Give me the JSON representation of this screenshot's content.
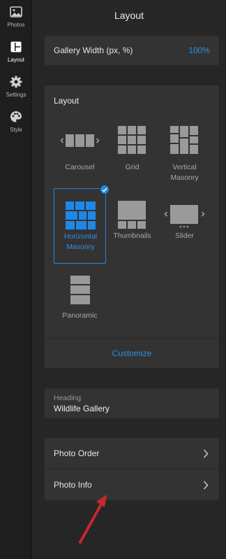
{
  "sidebar": {
    "items": [
      {
        "label": "Photos",
        "icon": "image-icon",
        "active": false
      },
      {
        "label": "Layout",
        "icon": "layout-icon",
        "active": true
      },
      {
        "label": "Settings",
        "icon": "gear-icon",
        "active": false
      },
      {
        "label": "Style",
        "icon": "palette-icon",
        "active": false
      }
    ]
  },
  "panel": {
    "title": "Layout",
    "gallery_width": {
      "label": "Gallery Width (px, %)",
      "value": "100%"
    },
    "layout": {
      "title": "Layout",
      "options": [
        {
          "label": "Carousel",
          "icon": "carousel-icon",
          "selected": false
        },
        {
          "label": "Grid",
          "icon": "grid-icon",
          "selected": false
        },
        {
          "label": "Vertical Masonry",
          "icon": "vertical-masonry-icon",
          "selected": false
        },
        {
          "label": "Horizontal Masonry",
          "icon": "horizontal-masonry-icon",
          "selected": true
        },
        {
          "label": "Thumbnails",
          "icon": "thumbnails-icon",
          "selected": false
        },
        {
          "label": "Slider",
          "icon": "slider-icon",
          "selected": false
        },
        {
          "label": "Panoramic",
          "icon": "panoramic-icon",
          "selected": false
        }
      ],
      "customize_label": "Customize"
    },
    "heading": {
      "label": "Heading",
      "value": "Wildlife Gallery"
    },
    "rows": [
      {
        "label": "Photo Order"
      },
      {
        "label": "Photo Info"
      }
    ]
  },
  "colors": {
    "accent": "#1e88e5",
    "panel_bg": "#262626",
    "card_bg": "#333333",
    "rail_bg": "#1e1e1e",
    "annotation_arrow": "#c62828"
  }
}
